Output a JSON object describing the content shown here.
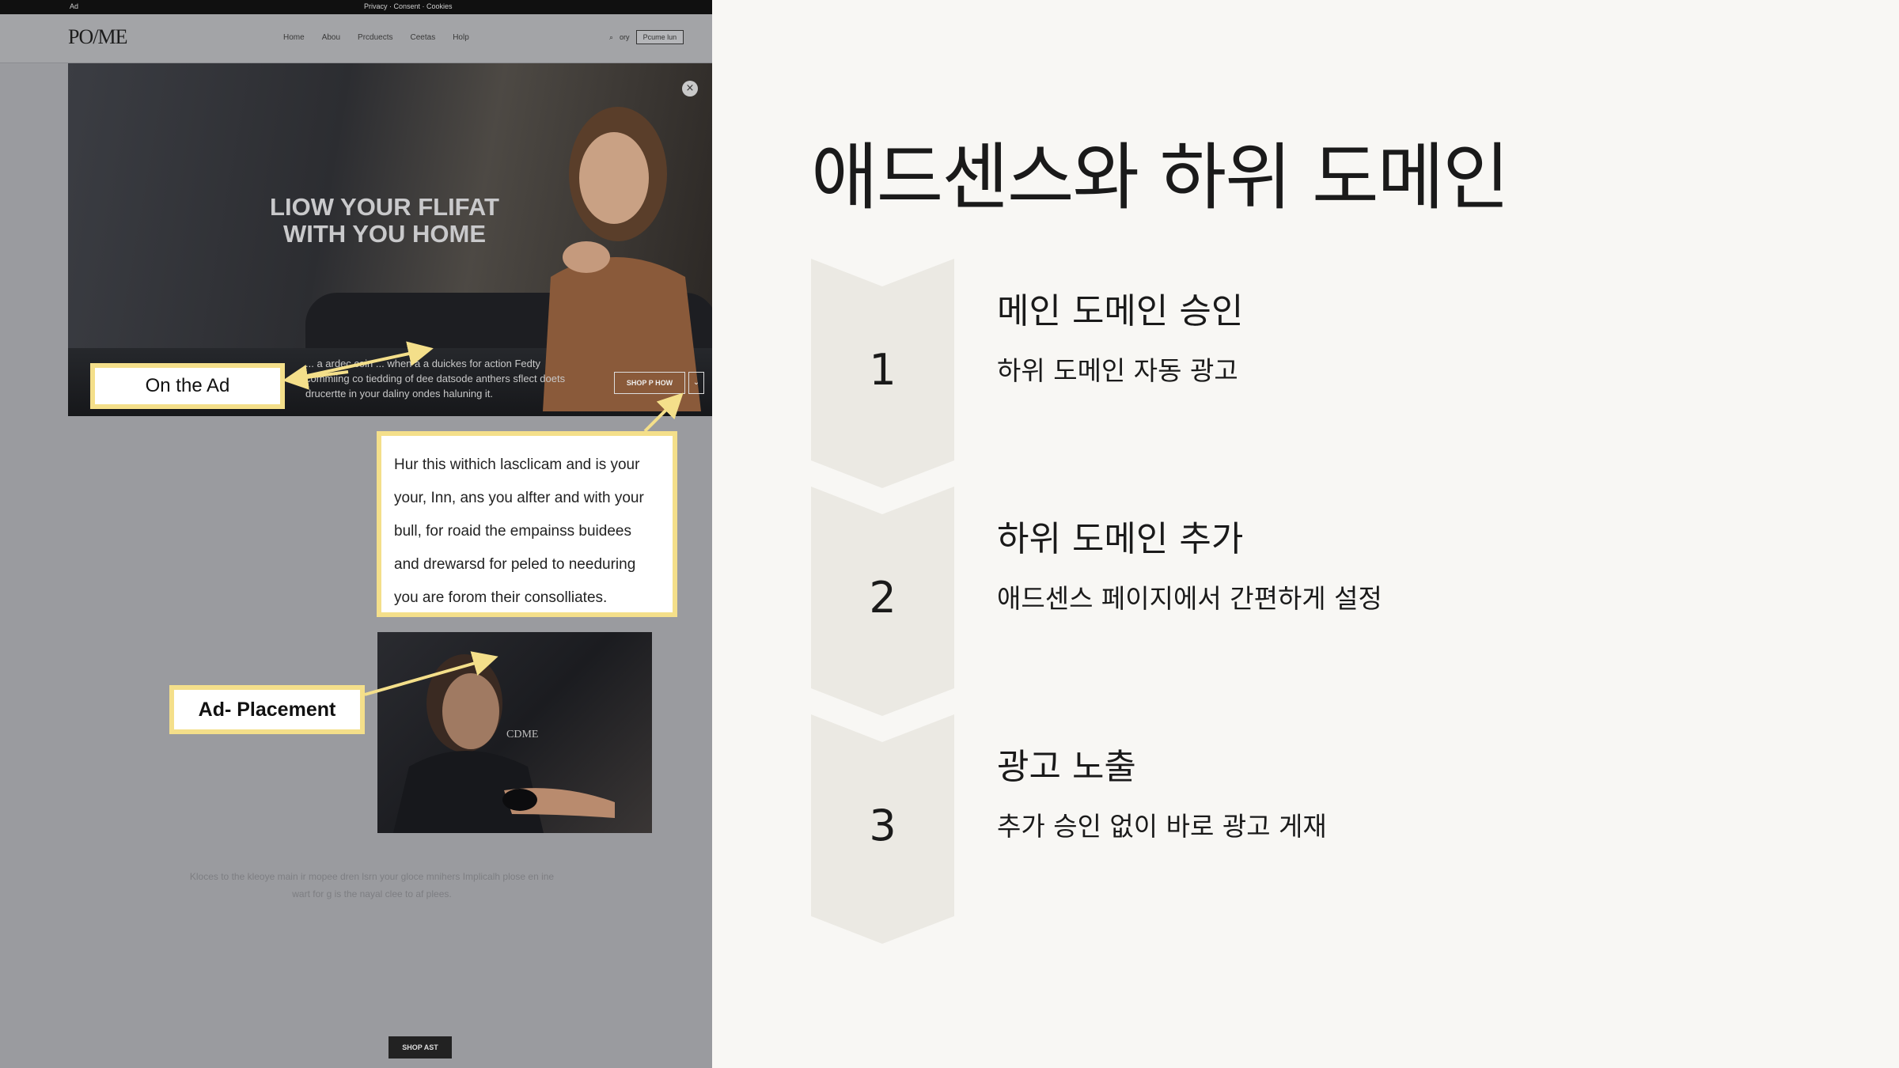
{
  "screenshot": {
    "topbar": {
      "left": "Ad",
      "center": "Privacy · Consent · Cookies"
    },
    "logo": "PO/ME",
    "nav_links": [
      "Home",
      "Abou",
      "Prcduects",
      "Ceetas",
      "Holp"
    ],
    "nav_right": {
      "text": "ory",
      "button": "Pcume lun"
    },
    "hero": {
      "title_line1": "LIOW YOUR FLIFAT",
      "title_line2": "WITH YOU HOME",
      "desc_line1": "... a ardec coin ... when a a duickes for action Fedty",
      "desc_line2": "commiing co tiedding of dee datsode anthers sflect doets",
      "desc_line3": "drucertte in your daliny ondes haluning it.",
      "shop_button": "SHOP P HOW",
      "close": "×"
    },
    "callout_on_ad": "On the Ad",
    "callout_text_lines": [
      "Hur this withich lasclicam and is your",
      "your, Inn, ans you alfter and with your",
      "bull, for roaid the empainss buidees",
      "and drewarsd for peled to needuring",
      "you are forom their consolliates."
    ],
    "callout_placement": "Ad- Placement",
    "product_label": "CDME",
    "footer_line1": "Kloces to the kleoye main ir mopee dren lsrn your gloce mnihers Implicalh plose en ine",
    "footer_line2": "wart for g is the nayal clee to af plees.",
    "footer_button": "SHOP AST"
  },
  "slide": {
    "title": "애드센스와 하위 도메인",
    "steps": [
      {
        "number": "1",
        "heading": "메인 도메인 승인",
        "body": "하위 도메인 자동 광고"
      },
      {
        "number": "2",
        "heading": "하위 도메인 추가",
        "body": "애드센스 페이지에서 간편하게 설정"
      },
      {
        "number": "3",
        "heading": "광고 노출",
        "body": "추가 승인 없이 바로 광고 게재"
      }
    ]
  },
  "colors": {
    "slide_background": "#f8f7f4",
    "chevron_fill": "#ebe9e3",
    "callout_border": "#f4df8a",
    "arrow": "#f4df8a"
  }
}
